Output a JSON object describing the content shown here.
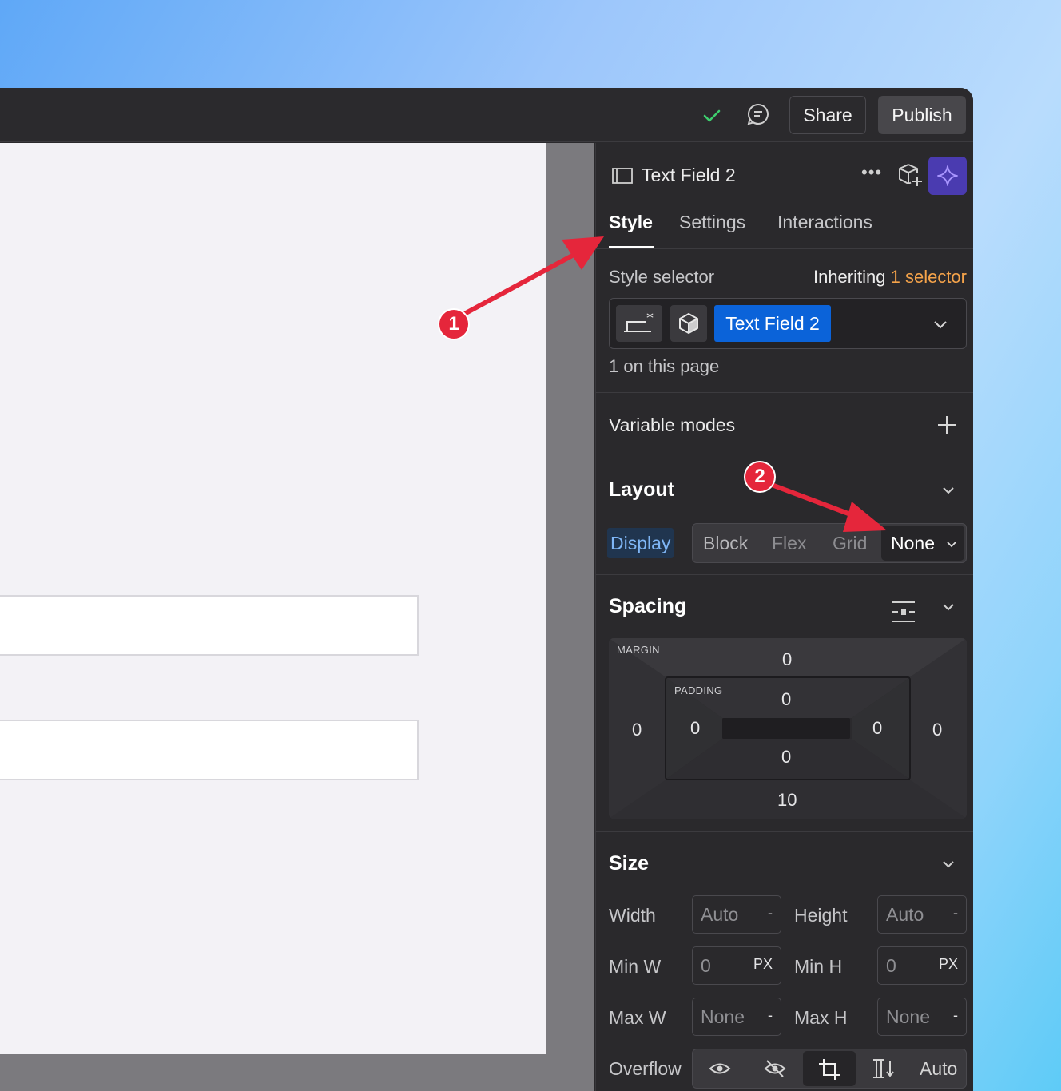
{
  "topbar": {
    "share_label": "Share",
    "publish_label": "Publish"
  },
  "panel": {
    "element_name": "Text Field 2",
    "more_label": "•••",
    "tabs": [
      {
        "label": "Style"
      },
      {
        "label": "Settings"
      },
      {
        "label": "Interactions"
      }
    ],
    "style_selector": {
      "label": "Style selector",
      "inherit_prefix": "Inheriting",
      "inherit_count": "1 selector",
      "tag": "Text Field 2",
      "on_page": "1 on this page"
    },
    "variable_modes": {
      "label": "Variable modes"
    },
    "layout": {
      "title": "Layout",
      "display_label": "Display",
      "options": [
        "Block",
        "Flex",
        "Grid"
      ],
      "selected": "None"
    },
    "spacing": {
      "title": "Spacing",
      "margin_label": "MARGIN",
      "padding_label": "PADDING",
      "margin": {
        "top": "0",
        "right": "0",
        "bottom": "10",
        "left": "0"
      },
      "padding": {
        "top": "0",
        "right": "0",
        "bottom": "0",
        "left": "0"
      }
    },
    "size": {
      "title": "Size",
      "width_label": "Width",
      "width_value": "Auto",
      "width_unit": "-",
      "height_label": "Height",
      "height_value": "Auto",
      "height_unit": "-",
      "minw_label": "Min W",
      "minw_value": "0",
      "minw_unit": "PX",
      "minh_label": "Min H",
      "minh_value": "0",
      "minh_unit": "PX",
      "maxw_label": "Max W",
      "maxw_value": "None",
      "maxw_unit": "-",
      "maxh_label": "Max H",
      "maxh_value": "None",
      "maxh_unit": "-",
      "overflow_label": "Overflow",
      "overflow_auto": "Auto"
    }
  },
  "annotations": [
    {
      "number": "1"
    },
    {
      "number": "2"
    }
  ],
  "colors": {
    "accent_blue": "#0b63d9",
    "annotation_red": "#e5263b",
    "inherit_orange": "#f5a34a"
  }
}
